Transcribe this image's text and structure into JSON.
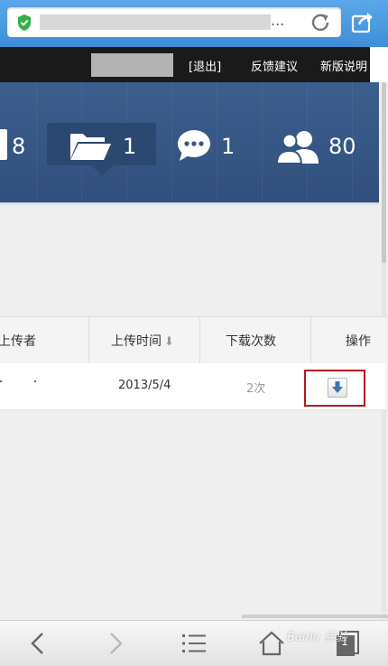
{
  "browser": {
    "url_suffix": "...",
    "accent_color": "#4a9ae0"
  },
  "top_nav": {
    "logout": "[退出]",
    "feedback": "反馈建议",
    "new_version": "新版说明"
  },
  "stats": [
    {
      "icon": "file-icon",
      "count": "8"
    },
    {
      "icon": "folder-icon",
      "count": "1",
      "selected": true
    },
    {
      "icon": "chat-bubble-icon",
      "count": "1"
    },
    {
      "icon": "users-icon",
      "count": "80"
    }
  ],
  "table": {
    "headers": {
      "uploader": "上传者",
      "upload_time": "上传时间",
      "download_count": "下载次数",
      "actions": "操作"
    },
    "sort_arrow": "⬇",
    "rows": [
      {
        "uploader": "",
        "upload_time": "2013/5/4",
        "download_count": "2次",
        "action_icon": "download-icon"
      }
    ]
  },
  "toolbar": {
    "tab_count": "1",
    "icons": [
      "back-icon",
      "forward-icon",
      "menu-icon",
      "home-icon",
      "tabs-icon"
    ]
  },
  "watermark": "Baidu 经验",
  "colors": {
    "banner": "#36567f",
    "highlight_border": "#b3191c",
    "download_arrow": "#3f74b8"
  }
}
